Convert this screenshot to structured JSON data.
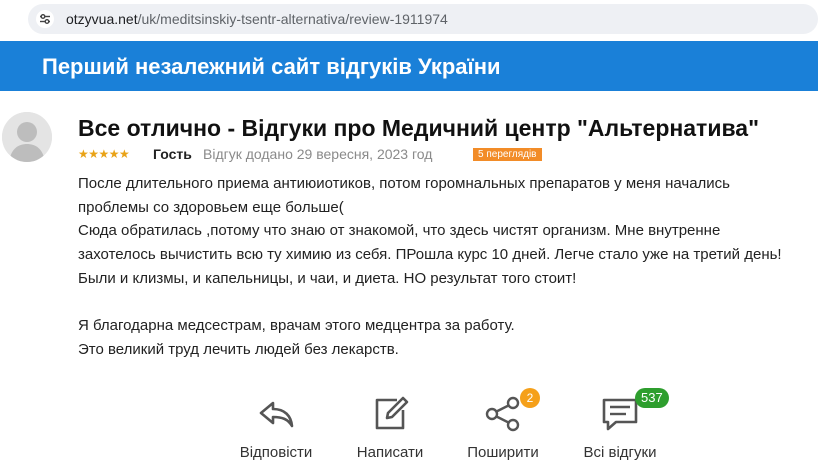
{
  "browser": {
    "url_host": "otzyvua.net",
    "url_path": "/uk/meditsinskiy-tsentr-alternativa/review-1911974",
    "site_info_icon": "tune-icon"
  },
  "banner": {
    "title": "Перший незалежний сайт відгуків України"
  },
  "review": {
    "avatar_icon": "user-avatar-icon",
    "title": "Все отлично - Відгуки про Медичний центр \"Альтернатива\"",
    "rating": 5,
    "stars_text": "★★★★★",
    "author": "Гость",
    "date": "Відгук додано 29 вересня, 2023 год",
    "views": "5 переглядів",
    "body": [
      "После длительного приема антиюиотиков, потом горомнальных препаратов у меня начались",
      "проблемы со здоровьем еще больше(",
      "Сюда обратилась ,потому что знаю от знакомой, что здесь чистят организм. Мне внутренне",
      "захотелось вычистить всю ту химию из себя. ПРошла курс 10 дней. Легче стало уже на третий день!",
      "Были и клизмы, и капельницы, и чаи, и диета. НО результат того стоит!",
      "",
      "Я благодарна медсестрам, врачам этого медцентра за работу.",
      "Это великий труд лечить людей без лекарств."
    ]
  },
  "actions": {
    "reply": {
      "label": "Відповісти",
      "icon": "reply-icon"
    },
    "write": {
      "label": "Написати",
      "icon": "edit-icon"
    },
    "share": {
      "label": "Поширити",
      "icon": "share-icon",
      "badge": "2",
      "badge_color": "#f5a01a"
    },
    "all_reviews": {
      "label": "Всі відгуки",
      "icon": "comment-icon",
      "badge": "537",
      "badge_color": "#2e9e2e"
    }
  },
  "colors": {
    "banner_bg": "#1a80d8",
    "stars": "#e9a317",
    "views_badge": "#f28c28"
  }
}
